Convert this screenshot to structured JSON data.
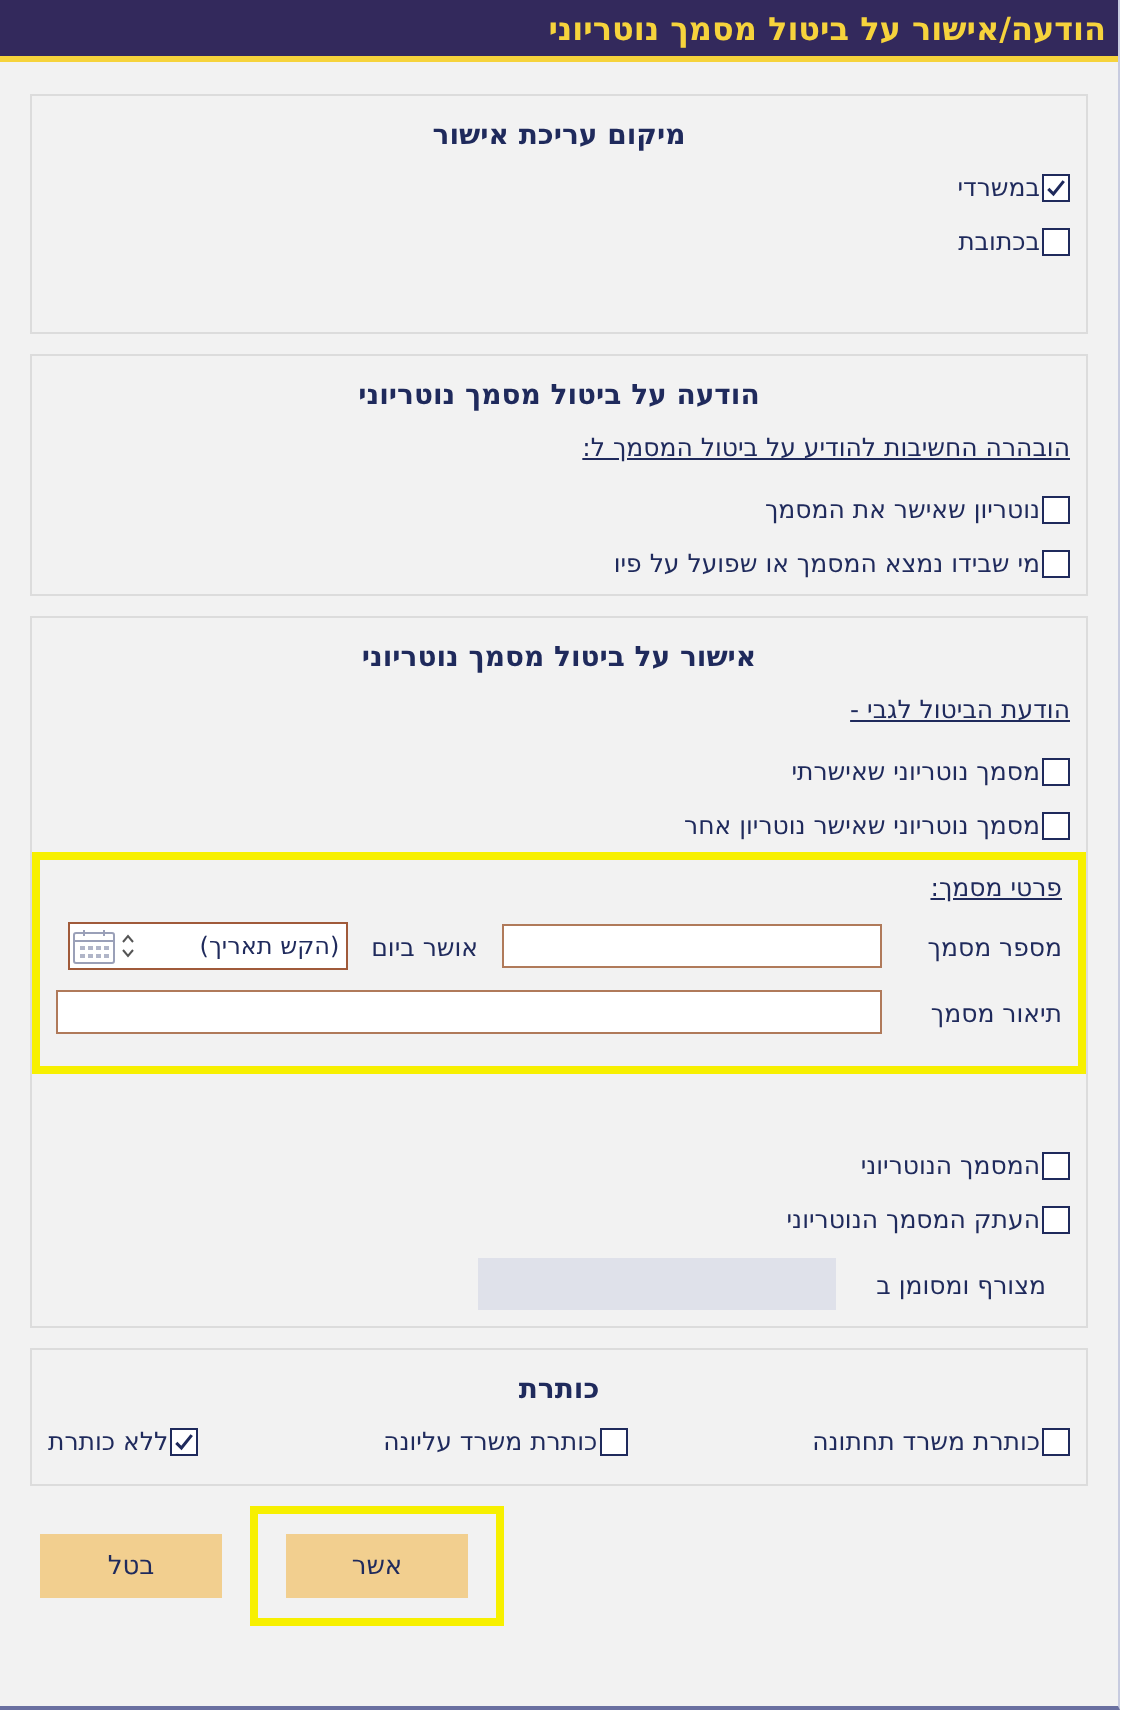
{
  "window": {
    "title": "הודעה/אישור על ביטול מסמך נוטריוני"
  },
  "location": {
    "heading": "מיקום עריכת אישור",
    "options": [
      {
        "label": "במשרדי",
        "checked": true
      },
      {
        "label": "בכתובת",
        "checked": false
      }
    ]
  },
  "notice": {
    "heading": "הודעה על ביטול מסמך נוטריוני",
    "subheading": "הובהרה החשיבות להודיע על ביטול המסמך ל:",
    "options": [
      {
        "label": "נוטריון שאישר את המסמך",
        "checked": false
      },
      {
        "label": "מי שבידו נמצא המסמך או שפועל על פיו",
        "checked": false
      }
    ]
  },
  "approval": {
    "heading": "אישור על ביטול מסמך נוטריוני",
    "subheading": "הודעת הביטול לגבי -",
    "options": [
      {
        "label": "מסמך נוטריוני שאישרתי",
        "checked": false
      },
      {
        "label": "מסמך נוטריוני שאישר נוטריון אחר",
        "checked": false
      }
    ],
    "details": {
      "highlighted": true,
      "heading": "פרטי מסמך:",
      "number_label": "מספר מסמך",
      "date_label": "אושר ביום",
      "date_placeholder": "(הקש תאריך)",
      "description_label": "תיאור מסמך"
    },
    "attachments": [
      {
        "label": "המסמך הנוטריוני",
        "checked": false
      },
      {
        "label": "העתק המסמך הנוטריוני",
        "checked": false
      }
    ],
    "attached_label": "מצורף ומסומן ב"
  },
  "letterhead": {
    "heading": "כותרת",
    "options": [
      {
        "label": "כותרת משרד תחתונה",
        "checked": false
      },
      {
        "label": "כותרת משרד עליונה",
        "checked": false
      },
      {
        "label": "ללא כותרת",
        "checked": true
      }
    ]
  },
  "buttons": [
    {
      "label": "אשר",
      "highlighted": true
    },
    {
      "label": "בטל",
      "highlighted": false
    }
  ]
}
